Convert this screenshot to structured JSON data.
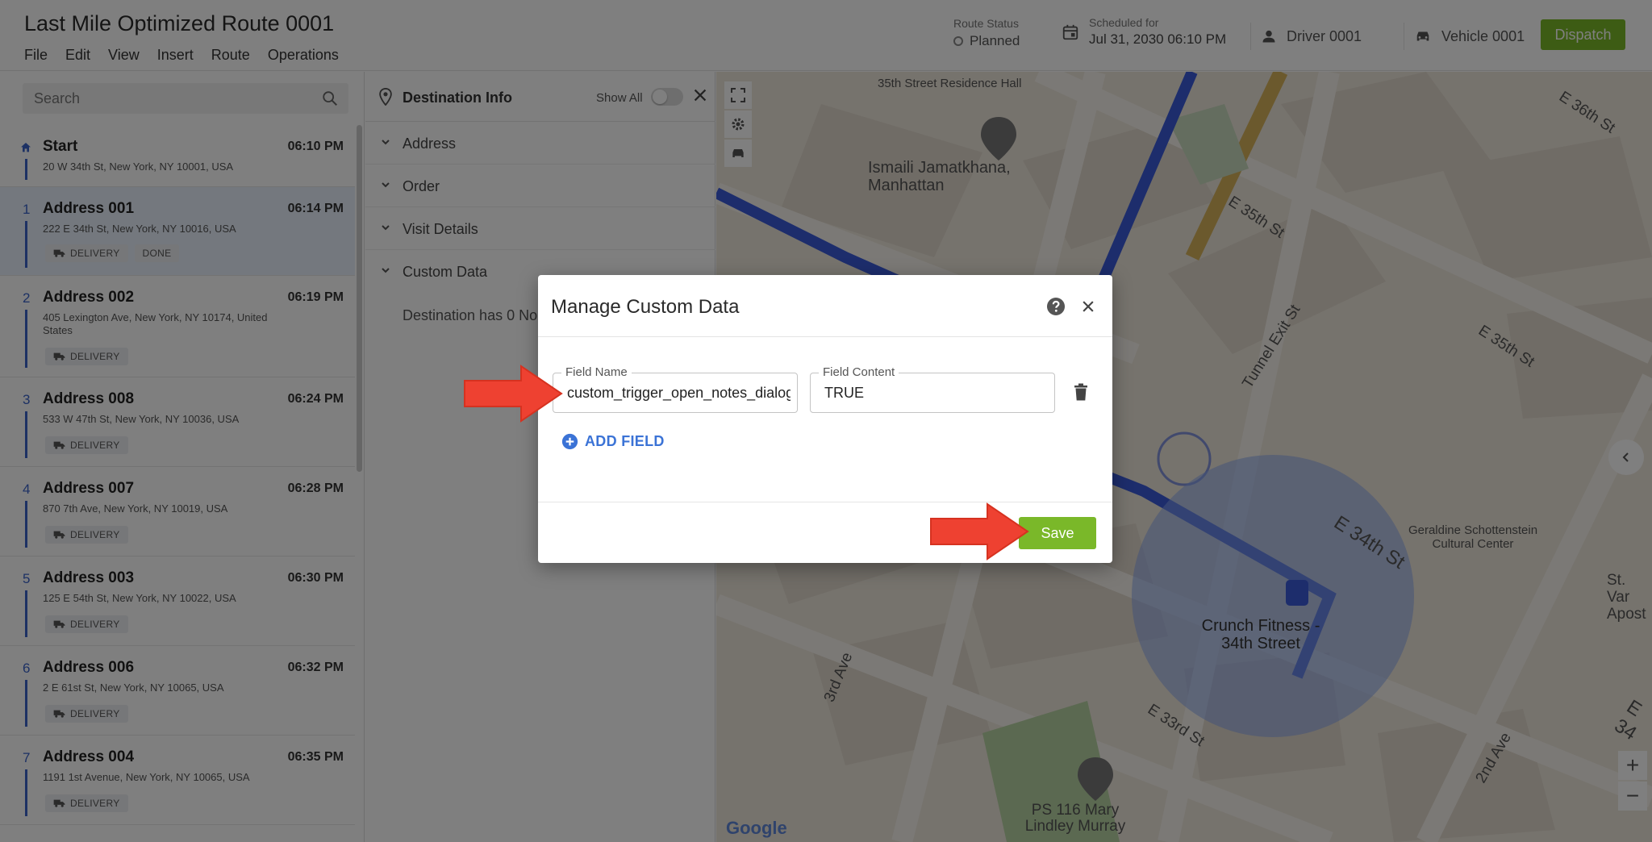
{
  "header": {
    "route_title": "Last Mile Optimized Route 0001",
    "menu": [
      "File",
      "Edit",
      "View",
      "Insert",
      "Route",
      "Operations"
    ],
    "status_label": "Route Status",
    "status_value": "Planned",
    "scheduled_label": "Scheduled for",
    "scheduled_value": "Jul 31, 2030 06:10 PM",
    "driver": "Driver 0001",
    "vehicle": "Vehicle 0001",
    "dispatch_label": "Dispatch",
    "accent": "#7ab829"
  },
  "sidebar": {
    "search_placeholder": "Search",
    "stops": [
      {
        "num": "",
        "name": "Start",
        "address": "20 W 34th St, New York, NY 10001, USA",
        "time": "06:10 PM",
        "badges": []
      },
      {
        "num": "1",
        "name": "Address 001",
        "address": "222 E 34th St, New York, NY 10016, USA",
        "time": "06:14 PM",
        "badges": [
          "DELIVERY",
          "DONE"
        ]
      },
      {
        "num": "2",
        "name": "Address 002",
        "address": "405 Lexington Ave, New York, NY 10174, United States",
        "time": "06:19 PM",
        "badges": [
          "DELIVERY"
        ]
      },
      {
        "num": "3",
        "name": "Address 008",
        "address": "533 W 47th St, New York, NY 10036, USA",
        "time": "06:24 PM",
        "badges": [
          "DELIVERY"
        ]
      },
      {
        "num": "4",
        "name": "Address 007",
        "address": "870 7th Ave, New York, NY 10019, USA",
        "time": "06:28 PM",
        "badges": [
          "DELIVERY"
        ]
      },
      {
        "num": "5",
        "name": "Address 003",
        "address": "125 E 54th St, New York, NY 10022, USA",
        "time": "06:30 PM",
        "badges": [
          "DELIVERY"
        ]
      },
      {
        "num": "6",
        "name": "Address 006",
        "address": "2 E 61st St, New York, NY 10065, USA",
        "time": "06:32 PM",
        "badges": [
          "DELIVERY"
        ]
      },
      {
        "num": "7",
        "name": "Address 004",
        "address": "1191 1st Avenue, New York, NY 10065, USA",
        "time": "06:35 PM",
        "badges": [
          "DELIVERY"
        ]
      }
    ]
  },
  "panel": {
    "title": "Destination Info",
    "show_all": "Show All",
    "sections": [
      "Address",
      "Order",
      "Visit Details",
      "Custom Data"
    ],
    "empty_text": "Destination has 0 No"
  },
  "map": {
    "labels": [
      "35th Street Residence Hall",
      "Ismaili Jamatkhana, Manhattan",
      "E 36th St",
      "E 35th St",
      "E 35th St",
      "Tunnel Exit St",
      "E 34th St",
      "Geraldine Schottenstein Cultural Center",
      "St. Var Apost",
      "Crunch Fitness - 34th Street",
      "3rd Ave",
      "E 33rd St",
      "2nd Ave",
      "E 34",
      "PS 116 Mary Lindley Murray"
    ],
    "google": "Google",
    "route_color": "#3a5bd9"
  },
  "modal": {
    "title": "Manage Custom Data",
    "field_name_label": "Field Name",
    "field_name_value": "custom_trigger_open_notes_dialog",
    "field_content_label": "Field Content",
    "field_content_value": "TRUE",
    "add_field_label": "ADD FIELD",
    "save_label": "Save",
    "arrow_color": "#ee4131"
  }
}
